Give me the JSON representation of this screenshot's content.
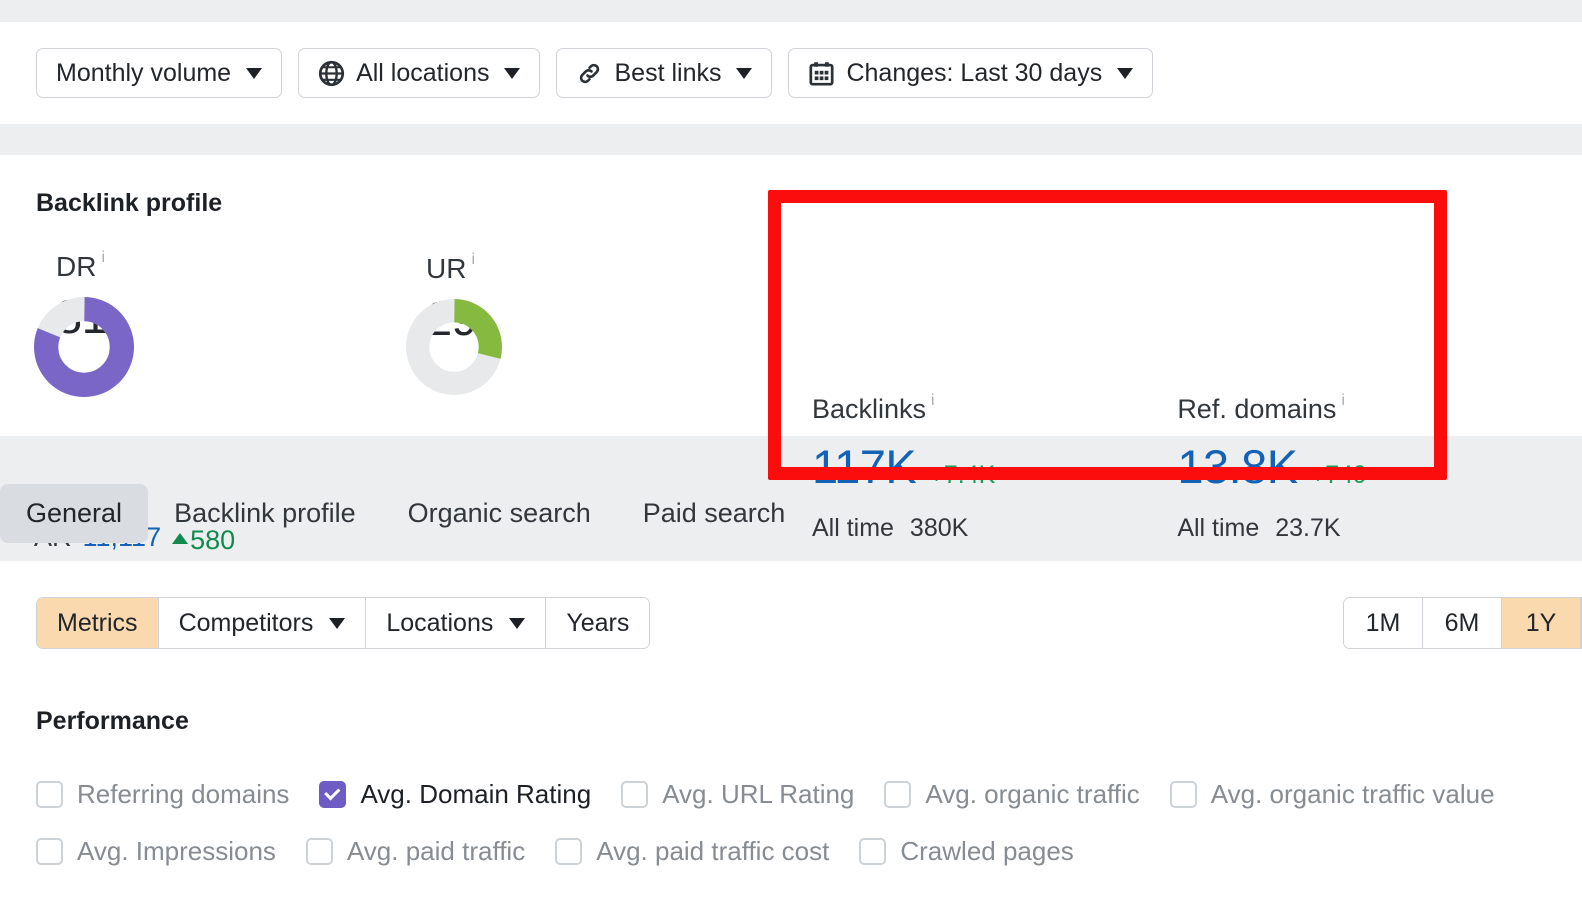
{
  "colors": {
    "accent_blue": "#1362b5",
    "accent_green": "#1a9e5a",
    "dr_purple": "#7a66c7",
    "ur_green": "#85b940",
    "highlight_red": "#fc0d0d",
    "highlight_orange": "#fbd9ae",
    "page_bg": "#eceef0"
  },
  "filter_bar": {
    "buttons": [
      {
        "label": "Monthly volume",
        "icon": "",
        "caret": true
      },
      {
        "label": "All locations",
        "icon": "globe-icon",
        "caret": true
      },
      {
        "label": "Best links",
        "icon": "link-icon",
        "caret": true
      },
      {
        "label": "Changes: Last 30 days",
        "icon": "calendar-icon",
        "caret": true
      }
    ]
  },
  "backlink_profile": {
    "title": "Backlink profile",
    "dr": {
      "label": "DR",
      "value": "81",
      "info": "i",
      "percent": 81
    },
    "ur": {
      "label": "UR",
      "value": "29",
      "info": "i",
      "percent": 29
    },
    "ar": {
      "label": "AR",
      "value": "11,117",
      "delta": "580",
      "delta_direction": "up"
    },
    "stats": [
      {
        "label": "Backlinks",
        "info": "i",
        "value": "117K",
        "delta": "+7.4K",
        "alltime_label": "All time",
        "alltime_value": "380K"
      },
      {
        "label": "Ref. domains",
        "info": "i",
        "value": "13.8K",
        "delta": "+749",
        "alltime_label": "All time",
        "alltime_value": "23.7K"
      }
    ]
  },
  "tabs": [
    {
      "label": "General",
      "active": true
    },
    {
      "label": "Backlink profile",
      "active": false
    },
    {
      "label": "Organic search",
      "active": false
    },
    {
      "label": "Paid search",
      "active": false
    }
  ],
  "metrics_toolbar": {
    "left_segments": [
      {
        "label": "Metrics",
        "caret": false,
        "active": true
      },
      {
        "label": "Competitors",
        "caret": true,
        "active": false
      },
      {
        "label": "Locations",
        "caret": true,
        "active": false
      },
      {
        "label": "Years",
        "caret": false,
        "active": false
      }
    ],
    "range_segments": [
      {
        "label": "1M",
        "active": false
      },
      {
        "label": "6M",
        "active": false
      },
      {
        "label": "1Y",
        "active": true
      }
    ]
  },
  "performance": {
    "title": "Performance",
    "rows": [
      [
        {
          "label": "Referring domains",
          "checked": false
        },
        {
          "label": "Avg. Domain Rating",
          "checked": true
        },
        {
          "label": "Avg. URL Rating",
          "checked": false
        },
        {
          "label": "Avg. organic traffic",
          "checked": false
        },
        {
          "label": "Avg. organic traffic value",
          "checked": false
        }
      ],
      [
        {
          "label": "Avg. Impressions",
          "checked": false
        },
        {
          "label": "Avg. paid traffic",
          "checked": false
        },
        {
          "label": "Avg. paid traffic cost",
          "checked": false
        },
        {
          "label": "Crawled pages",
          "checked": false
        }
      ]
    ]
  }
}
